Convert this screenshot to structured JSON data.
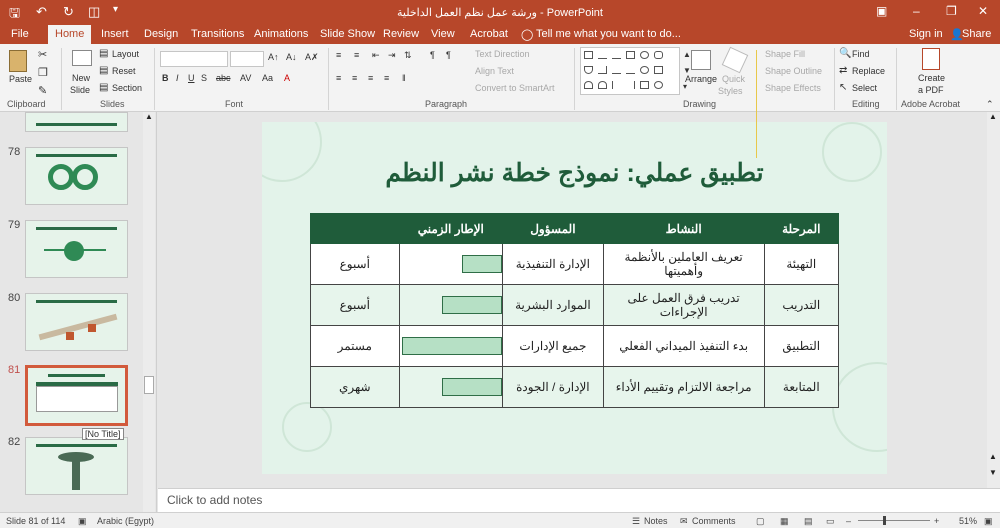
{
  "titlebar": {
    "title": "ورشة عمل نظم العمل الداخلية - PowerPoint",
    "colors": {
      "accent": "#b7472a",
      "slide_green": "#1f5c3a"
    }
  },
  "tabs": [
    "File",
    "Home",
    "Insert",
    "Design",
    "Transitions",
    "Animations",
    "Slide Show",
    "Review",
    "View",
    "Acrobat"
  ],
  "tellme": "Tell me what you want to do...",
  "account": {
    "signin": "Sign in",
    "share": "Share"
  },
  "ribbon": {
    "clipboard": {
      "paste": "Paste",
      "label": "Clipboard"
    },
    "slides": {
      "new_slide_1": "New",
      "new_slide_2": "Slide",
      "layout": "Layout",
      "reset": "Reset",
      "section": "Section",
      "label": "Slides"
    },
    "font": {
      "label": "Font"
    },
    "paragraph": {
      "text_direction": "Text Direction",
      "align_text": "Align Text",
      "smartart": "Convert to SmartArt",
      "label": "Paragraph"
    },
    "drawing": {
      "arrange": "Arrange",
      "quick_styles_1": "Quick",
      "quick_styles_2": "Styles",
      "shape_fill": "Shape Fill",
      "shape_outline": "Shape Outline",
      "shape_effects": "Shape Effects",
      "label": "Drawing"
    },
    "editing": {
      "find": "Find",
      "replace": "Replace",
      "select": "Select",
      "label": "Editing"
    },
    "acrobat": {
      "create_1": "Create",
      "create_2": "a PDF",
      "label": "Adobe Acrobat"
    }
  },
  "thumbnails": [
    {
      "num": "78"
    },
    {
      "num": "79"
    },
    {
      "num": "80"
    },
    {
      "num": "81"
    },
    {
      "num": "82"
    }
  ],
  "tooltip": "[No Title]",
  "slide": {
    "title": "تطبيق عملي: نموذج خطة نشر النظم",
    "headers": [
      "المرحلة",
      "النشاط",
      "المسؤول",
      "الإطار الزمني"
    ],
    "rows": [
      {
        "phase": "التهيئة",
        "activity": "تعريف العاملين بالأنظمة وأهميتها",
        "owner": "الإدارة التنفيذية",
        "duration": "أسبوع",
        "bar_fraction": 0.4
      },
      {
        "phase": "التدريب",
        "activity": "تدريب فرق العمل على الإجراءات",
        "owner": "الموارد البشرية",
        "duration": "أسبوع",
        "bar_fraction": 0.6
      },
      {
        "phase": "التطبيق",
        "activity": "بدء التنفيذ الميداني الفعلي",
        "owner": "جميع الإدارات",
        "duration": "مستمر",
        "bar_fraction": 1.0
      },
      {
        "phase": "المتابعة",
        "activity": "مراجعة الالتزام وتقييم الأداء",
        "owner": "الإدارة / الجودة",
        "duration": "شهري",
        "bar_fraction": 0.6
      }
    ]
  },
  "notes_placeholder": "Click to add notes",
  "status": {
    "slide": "Slide 81 of 114",
    "language": "Arabic (Egypt)",
    "notes": "Notes",
    "comments": "Comments",
    "zoom": "51%"
  }
}
